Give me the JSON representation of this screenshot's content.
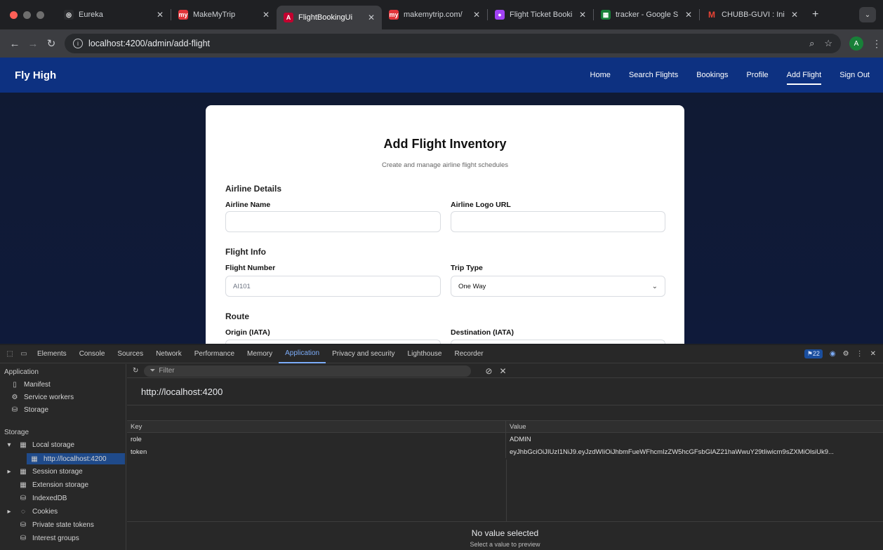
{
  "browser": {
    "tabs": [
      {
        "title": "Eureka",
        "fav_color": "#2a2b2e",
        "fav_glyph": "◎"
      },
      {
        "title": "MakeMyTrip",
        "fav_color": "#e2353a",
        "fav_glyph": "my"
      },
      {
        "title": "FlightBookingUi",
        "fav_color": "#c3002f",
        "fav_glyph": "A",
        "active": true
      },
      {
        "title": "makemytrip.com/",
        "fav_color": "#e2353a",
        "fav_glyph": "my"
      },
      {
        "title": "Flight Ticket Booki",
        "fav_color": "#a142f4",
        "fav_glyph": "●"
      },
      {
        "title": "tracker - Google S",
        "fav_color": "#188038",
        "fav_glyph": "▦"
      },
      {
        "title": "CHUBB-GUVI : Ini",
        "fav_color": "#1f2023",
        "fav_glyph": "M"
      }
    ],
    "url": "localhost:4200/admin/add-flight",
    "avatar_letter": "A"
  },
  "app": {
    "brand": "Fly High",
    "nav": [
      "Home",
      "Search Flights",
      "Bookings",
      "Profile",
      "Add Flight",
      "Sign Out"
    ],
    "active_nav": "Add Flight"
  },
  "form": {
    "title": "Add Flight Inventory",
    "subtitle": "Create and manage airline flight schedules",
    "sections": {
      "airline": "Airline Details",
      "flight": "Flight Info",
      "route": "Route"
    },
    "fields": {
      "airline_name": {
        "label": "Airline Name",
        "value": ""
      },
      "airline_logo": {
        "label": "Airline Logo URL",
        "value": ""
      },
      "flight_number": {
        "label": "Flight Number",
        "placeholder": "AI101"
      },
      "trip_type": {
        "label": "Trip Type",
        "value": "One Way"
      },
      "origin": {
        "label": "Origin (IATA)"
      },
      "destination": {
        "label": "Destination (IATA)"
      }
    }
  },
  "devtools": {
    "tabs": [
      "Elements",
      "Console",
      "Sources",
      "Network",
      "Performance",
      "Memory",
      "Application",
      "Privacy and security",
      "Lighthouse",
      "Recorder"
    ],
    "active_tab": "Application",
    "issues_count": "22",
    "sidebar": {
      "application_header": "Application",
      "manifest": "Manifest",
      "service_workers": "Service workers",
      "storage_item": "Storage",
      "storage_header": "Storage",
      "local_storage": "Local storage",
      "local_storage_origin": "http://localhost:4200",
      "session_storage": "Session storage",
      "extension_storage": "Extension storage",
      "indexeddb": "IndexedDB",
      "cookies": "Cookies",
      "private_state_tokens": "Private state tokens",
      "interest_groups": "Interest groups"
    },
    "filter_placeholder": "Filter",
    "origin": "http://localhost:4200",
    "table": {
      "key_header": "Key",
      "value_header": "Value",
      "rows": [
        {
          "key": "role",
          "value": "ADMIN"
        },
        {
          "key": "token",
          "value": "eyJhbGciOiJIUzI1NiJ9.eyJzdWIiOiJhbmFueWFhcmIzZW5hcGFsbGlAZ21haWwuY29tIiwicm9sZXMiOlsiUk9..."
        }
      ]
    },
    "preview_title": "No value selected",
    "preview_sub": "Select a value to preview"
  }
}
